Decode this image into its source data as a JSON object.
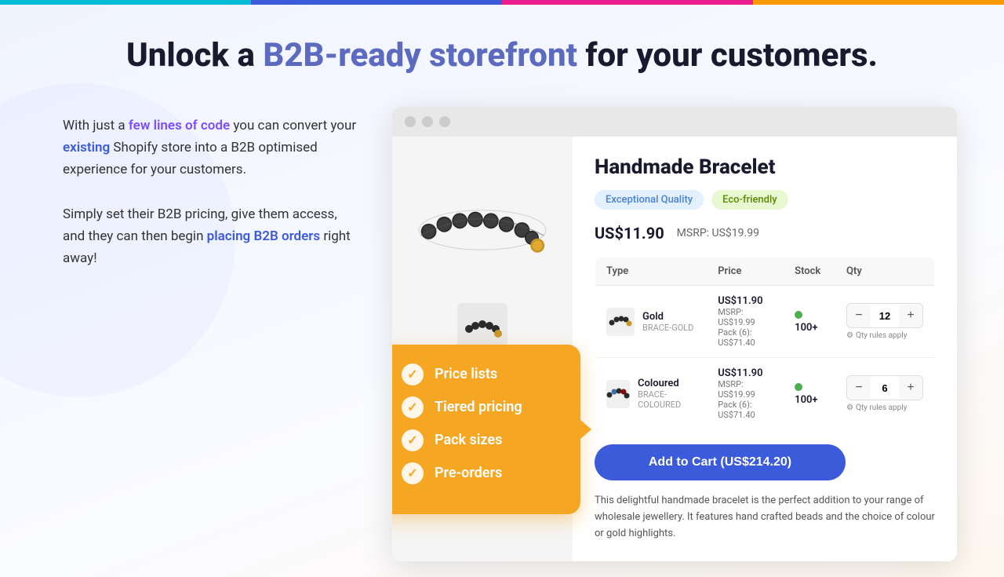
{
  "topBar": {
    "segments": [
      "cyan",
      "blue",
      "pink",
      "orange"
    ]
  },
  "headline": {
    "prefix": "Unlock a ",
    "highlight": "B2B-ready storefront",
    "suffix": " for your customers."
  },
  "leftColumn": {
    "intro": {
      "part1": "With just a ",
      "highlight1": "few lines of code",
      "part2": " you can convert your ",
      "highlight2": "existing",
      "part3": " Shopify store into a B2B optimised experience for your customers."
    },
    "secondary": {
      "part1": "Simply set their B2B pricing, give them access, and they can then begin ",
      "highlight": "placing B2B orders",
      "part2": " right away!"
    }
  },
  "featureBox": {
    "items": [
      "Price lists",
      "Tiered pricing",
      "Pack sizes",
      "Pre-orders"
    ]
  },
  "product": {
    "title": "Handmade Bracelet",
    "tags": [
      {
        "label": "Exceptional Quality",
        "style": "blue"
      },
      {
        "label": "Eco-friendly",
        "style": "green"
      }
    ],
    "price": "US$11.90",
    "msrp": "MSRP: US$19.99",
    "table": {
      "headers": [
        "Type",
        "Price",
        "Stock",
        "Qty"
      ],
      "rows": [
        {
          "type": "Gold",
          "sku": "BRACE-GOLD",
          "price": "US$11.90",
          "priceMsrp": "MSRP: US$19.99",
          "pricePack": "Pack (6): US$71.40",
          "stock": "100+",
          "qty": 12
        },
        {
          "type": "Coloured",
          "sku": "BRACE-COLOURED",
          "price": "US$11.90",
          "priceMsrp": "MSRP: US$19.99",
          "pricePack": "Pack (6): US$71.40",
          "stock": "100+",
          "qty": 6
        }
      ]
    },
    "addToCart": "Add to Cart (US$214.20)",
    "description": "This delightful handmade bracelet is the perfect addition to your range of wholesale jewellery. It features hand crafted beads and the choice of colour or gold highlights."
  }
}
